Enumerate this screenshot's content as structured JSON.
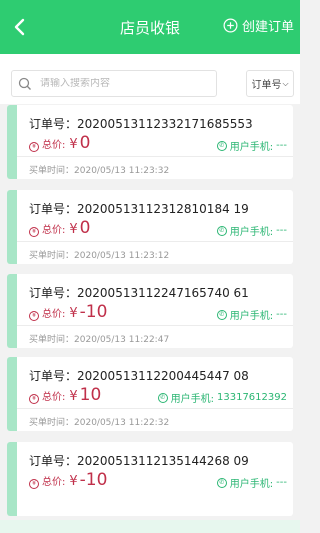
{
  "header": {
    "title": "店员收银",
    "create_label": "创建订单",
    "back_icon": "chevron-left-icon",
    "create_icon": "plus-circle-icon"
  },
  "search": {
    "placeholder": "请输入搜索内容",
    "filter_label": "订单号",
    "filter_chevron": "⌵"
  },
  "labels": {
    "order_prefix": "订单号：",
    "total": "总价:",
    "currency": "¥",
    "phone": "用户手机:",
    "time_prefix": "买单时间："
  },
  "orders": [
    {
      "order_no": "20200513112332171685553",
      "amount": "0",
      "phone": "---",
      "time": "2020/05/13 11:23:32"
    },
    {
      "order_no": "20200513112312810184 19",
      "amount": "0",
      "phone": "---",
      "time": "2020/05/13 11:23:12"
    },
    {
      "order_no": "20200513112247165740 61",
      "amount": "-10",
      "phone": "---",
      "time": "2020/05/13 11:22:47"
    },
    {
      "order_no": "20200513112200445447 08",
      "amount": "10",
      "phone": "13317612392",
      "time": "2020/05/13 11:22:32"
    },
    {
      "order_no": "20200513112135144268 09",
      "amount": "-10",
      "phone": "---",
      "time": ""
    }
  ],
  "colors": {
    "primary": "#2ecc71",
    "price": "#c0304a",
    "phone": "#2bb673",
    "stripe": "#a8e6c7"
  }
}
